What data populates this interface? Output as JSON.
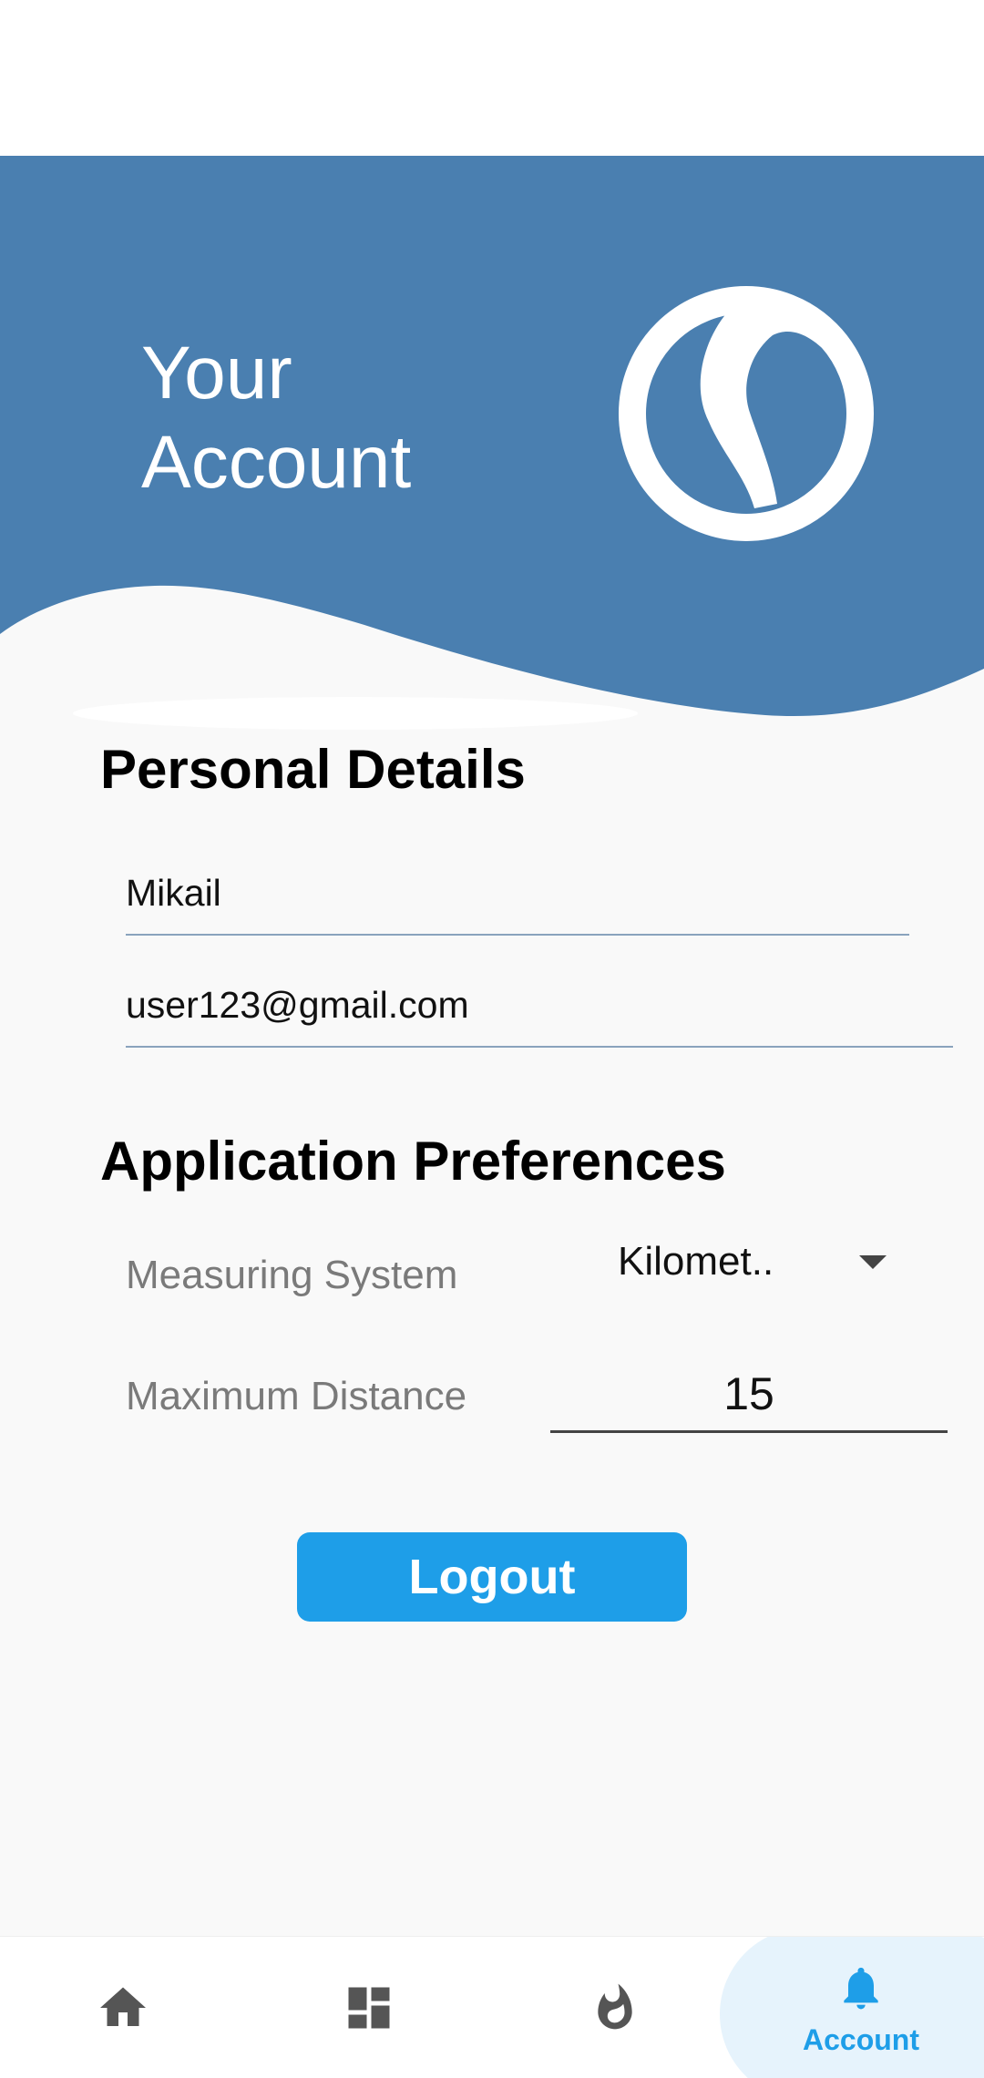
{
  "header": {
    "title_line1": "Your",
    "title_line2": "Account"
  },
  "personal": {
    "title": "Personal Details",
    "name_value": "Mikail",
    "email_value": "user123@gmail.com"
  },
  "preferences": {
    "title": "Application Preferences",
    "measuring_label": "Measuring System",
    "measuring_value": "Kilomet..",
    "distance_label": "Maximum Distance",
    "distance_value": "15"
  },
  "actions": {
    "logout_label": "Logout"
  },
  "nav": {
    "items": [
      {
        "icon": "home-icon",
        "label": ""
      },
      {
        "icon": "dashboard-icon",
        "label": ""
      },
      {
        "icon": "fire-icon",
        "label": ""
      },
      {
        "icon": "bell-icon",
        "label": "Account"
      }
    ]
  },
  "colors": {
    "brand": "#4a7fb0",
    "accent": "#1e9ee8",
    "active_nav_bg": "#e6f3fc"
  }
}
